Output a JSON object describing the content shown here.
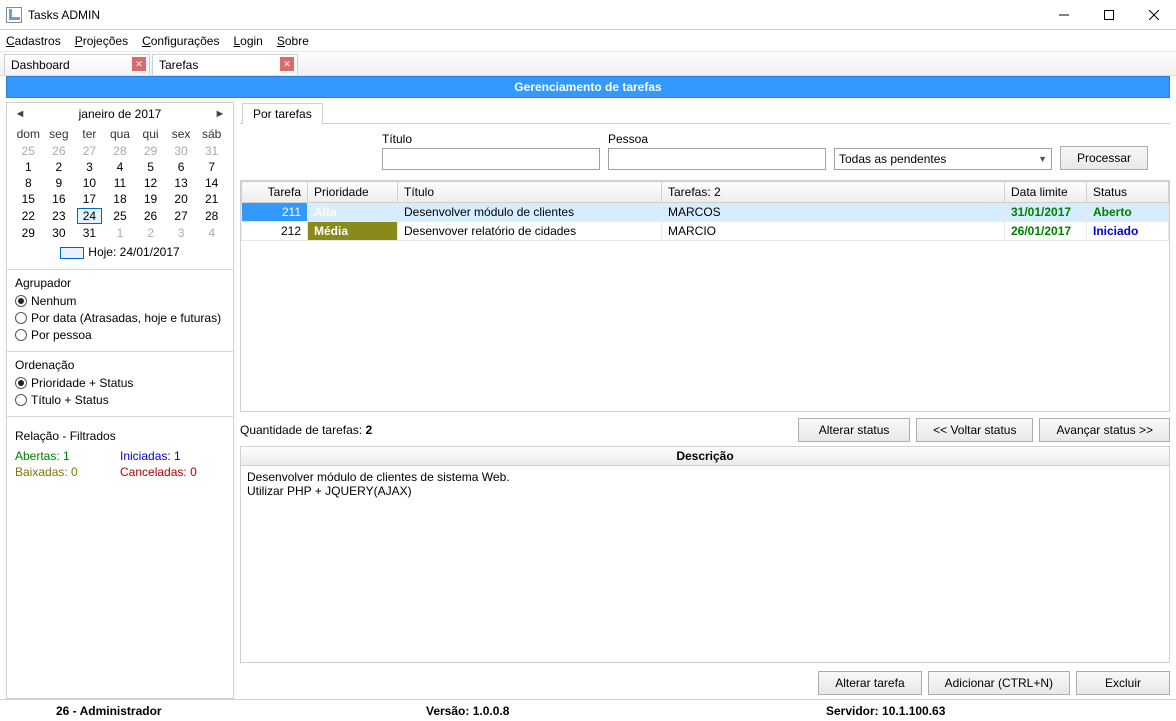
{
  "window": {
    "title": "Tasks ADMIN"
  },
  "menubar": [
    "Cadastros",
    "Projeções",
    "Configurações",
    "Login",
    "Sobre"
  ],
  "doc_tabs": [
    {
      "label": "Dashboard",
      "active": false
    },
    {
      "label": "Tarefas",
      "active": true
    }
  ],
  "banner": "Gerenciamento de tarefas",
  "calendar": {
    "title": "janeiro de 2017",
    "weekdays": [
      "dom",
      "seg",
      "ter",
      "qua",
      "qui",
      "sex",
      "sáb"
    ],
    "rows": [
      [
        {
          "d": "25",
          "o": true
        },
        {
          "d": "26",
          "o": true
        },
        {
          "d": "27",
          "o": true
        },
        {
          "d": "28",
          "o": true
        },
        {
          "d": "29",
          "o": true
        },
        {
          "d": "30",
          "o": true
        },
        {
          "d": "31",
          "o": true
        }
      ],
      [
        {
          "d": "1"
        },
        {
          "d": "2"
        },
        {
          "d": "3"
        },
        {
          "d": "4"
        },
        {
          "d": "5"
        },
        {
          "d": "6"
        },
        {
          "d": "7"
        }
      ],
      [
        {
          "d": "8"
        },
        {
          "d": "9"
        },
        {
          "d": "10"
        },
        {
          "d": "11"
        },
        {
          "d": "12"
        },
        {
          "d": "13"
        },
        {
          "d": "14"
        }
      ],
      [
        {
          "d": "15"
        },
        {
          "d": "16"
        },
        {
          "d": "17"
        },
        {
          "d": "18"
        },
        {
          "d": "19"
        },
        {
          "d": "20"
        },
        {
          "d": "21"
        }
      ],
      [
        {
          "d": "22"
        },
        {
          "d": "23"
        },
        {
          "d": "24",
          "today": true
        },
        {
          "d": "25"
        },
        {
          "d": "26"
        },
        {
          "d": "27"
        },
        {
          "d": "28"
        }
      ],
      [
        {
          "d": "29"
        },
        {
          "d": "30"
        },
        {
          "d": "31"
        },
        {
          "d": "1",
          "o": true
        },
        {
          "d": "2",
          "o": true
        },
        {
          "d": "3",
          "o": true
        },
        {
          "d": "4",
          "o": true
        }
      ]
    ],
    "today_label": "Hoje: 24/01/2017"
  },
  "grouping": {
    "header": "Agrupador",
    "options": [
      "Nenhum",
      "Por data (Atrasadas, hoje e futuras)",
      "Por pessoa"
    ],
    "selected": 0
  },
  "ordering": {
    "header": "Ordenação",
    "options": [
      "Prioridade + Status",
      "Título + Status"
    ],
    "selected": 0
  },
  "relation": {
    "header": "Relação - Filtrados",
    "abertas": {
      "label": "Abertas:",
      "value": "1"
    },
    "iniciadas": {
      "label": "Iniciadas:",
      "value": "1"
    },
    "baixadas": {
      "label": "Baixadas:",
      "value": "0"
    },
    "canceladas": {
      "label": "Canceladas:",
      "value": "0"
    }
  },
  "inner_tab": "Por tarefas",
  "filters": {
    "titulo_label": "Título",
    "titulo_value": "",
    "pessoa_label": "Pessoa",
    "pessoa_value": "",
    "status_value": "Todas as pendentes",
    "process_btn": "Processar"
  },
  "grid": {
    "headers": {
      "tarefa": "Tarefa",
      "prioridade": "Prioridade",
      "titulo": "Título",
      "tarefas": "Tarefas: 2",
      "data_limite": "Data limite",
      "status": "Status"
    },
    "rows": [
      {
        "id": "211",
        "prio": "Alta",
        "prio_cls": "prio-alta",
        "titulo": "Desenvolver módulo de clientes",
        "pessoa": "MARCOS",
        "data": "31/01/2017",
        "status": "Aberto",
        "status_cls": "status-aberto",
        "selected": true
      },
      {
        "id": "212",
        "prio": "Média",
        "prio_cls": "prio-media",
        "titulo": "Desenvover relatório de cidades",
        "pessoa": "MARCIO",
        "data": "26/01/2017",
        "status": "Iniciado",
        "status_cls": "status-iniciado",
        "selected": false
      }
    ]
  },
  "qty": {
    "label": "Quantidade de tarefas:",
    "value": "2"
  },
  "status_btns": {
    "alterar": "Alterar status",
    "voltar": "<< Voltar status",
    "avancar": "Avançar status >>"
  },
  "description": {
    "header": "Descrição",
    "body": "Desenvolver módulo de clientes de sistema Web.\nUtilizar PHP + JQUERY(AJAX)"
  },
  "bottom_btns": {
    "alterar_tarefa": "Alterar tarefa",
    "adicionar": "Adicionar (CTRL+N)",
    "excluir": "Excluir"
  },
  "statusbar": {
    "user": "26 - Administrador",
    "version": "Versão: 1.0.0.8",
    "server": "Servidor: 10.1.100.63"
  }
}
